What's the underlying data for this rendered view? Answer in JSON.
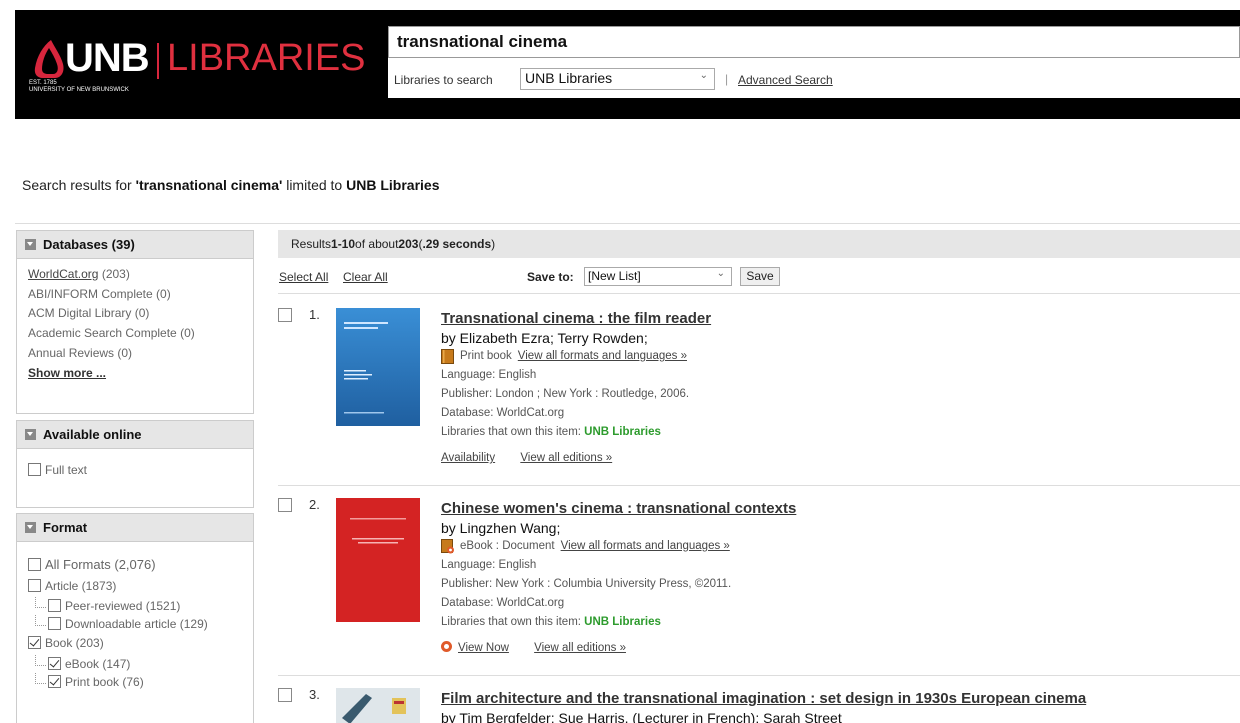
{
  "header": {
    "logo_unb": "UNB",
    "logo_libraries": "LIBRARIES",
    "logo_est": "EST. 1785",
    "logo_univ": "UNIVERSITY OF NEW BRUNSWICK",
    "search_value": "transnational cinema",
    "libraries_label": "Libraries to search",
    "libraries_value": "UNB Libraries",
    "advanced_search": "Advanced Search"
  },
  "summary": {
    "prefix": "Search results for ",
    "query": "'transnational cinema'",
    "middle": " limited to ",
    "scope": "UNB Libraries"
  },
  "facets": {
    "databases": {
      "title": "Databases (39)",
      "items": [
        {
          "label": "WorldCat.org",
          "count": "(203)"
        },
        {
          "label": "ABI/INFORM Complete",
          "count": "(0)"
        },
        {
          "label": "ACM Digital Library",
          "count": "(0)"
        },
        {
          "label": "Academic Search Complete",
          "count": "(0)"
        },
        {
          "label": "Annual Reviews",
          "count": "(0)"
        }
      ],
      "show_more": "Show more ..."
    },
    "available_online": {
      "title": "Available online",
      "full_text": "Full text"
    },
    "format": {
      "title": "Format",
      "all_formats": "All Formats",
      "all_count": "(2,076)",
      "article": "Article (1873)",
      "peer_reviewed": "Peer-reviewed (1521)",
      "downloadable": "Downloadable article (129)",
      "book": "Book (203)",
      "ebook": "eBook (147)",
      "print_book": "Print book (76)"
    }
  },
  "results_bar": {
    "prefix": "Results ",
    "range": "1-10",
    "middle": " of about ",
    "total": "203",
    "open": " (",
    "time": ".29 seconds",
    "close": ")"
  },
  "tools": {
    "select_all": "Select All",
    "clear_all": "Clear All",
    "save_to": "Save to:",
    "save_list": "[New List]",
    "save_button": "Save"
  },
  "results": [
    {
      "num": "1.",
      "title": "Transnational cinema : the film reader",
      "author": "by Elizabeth Ezra; Terry Rowden;",
      "format": "Print book",
      "formats_link": "View all formats and languages »",
      "language": "Language: English",
      "publisher": "Publisher: London ; New York : Routledge, 2006.",
      "database": "Database: WorldCat.org",
      "owned_label": "Libraries that own this item: ",
      "owned_value": "UNB Libraries",
      "link1": "Availability",
      "link2": "View all editions »",
      "cover_title": "Transnational Cinema\nThe Film Reader",
      "cover_color": "#2b7bc4"
    },
    {
      "num": "2.",
      "title": "Chinese women's cinema : transnational contexts",
      "author": "by Lingzhen Wang;",
      "format": "eBook : Document",
      "formats_link": "View all formats and languages »",
      "language": "Language: English",
      "publisher": "Publisher: New York : Columbia University Press, ©2011.",
      "database": "Database: WorldCat.org",
      "owned_label": "Libraries that own this item: ",
      "owned_value": "UNB Libraries",
      "link1": "View Now",
      "link2": "View all editions »",
      "cover_color": "#d42323"
    },
    {
      "num": "3.",
      "title": "Film architecture and the transnational imagination : set design in 1930s European cinema",
      "author": "by Tim Bergfelder; Sue Harris, (Lecturer in French); Sarah Street"
    }
  ],
  "colors": {
    "header_bg": "#000000",
    "brand_red": "#e0303f",
    "owned_green": "#2d9b2d"
  }
}
